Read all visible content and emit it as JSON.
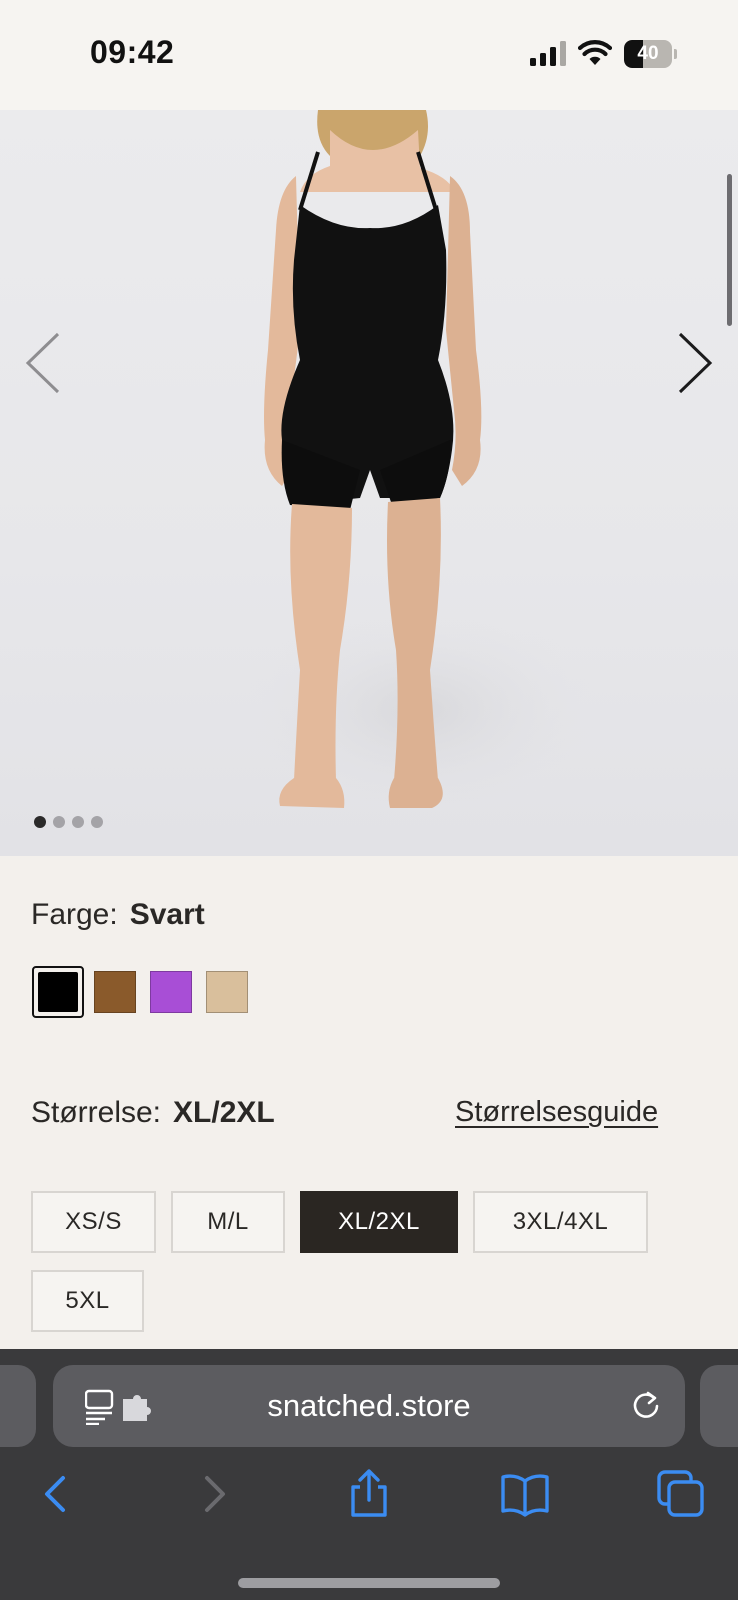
{
  "status_bar": {
    "time": "09:42",
    "battery_level": "40",
    "battery_fraction": 0.4
  },
  "gallery": {
    "image_count": 4,
    "active_index": 0,
    "prev_icon": "chevron-left-icon",
    "next_icon": "chevron-right-icon"
  },
  "color": {
    "label": "Farge:",
    "selected": "Svart",
    "swatches": [
      {
        "hex": "#000000",
        "selected": true
      },
      {
        "hex": "#8a5a2b",
        "selected": false
      },
      {
        "hex": "#a84ed6",
        "selected": false
      },
      {
        "hex": "#d9bf9c",
        "selected": false
      }
    ]
  },
  "size": {
    "label": "Størrelse:",
    "selected": "XL/2XL",
    "guide_link": "Størrelsesguide",
    "options": [
      "XS/S",
      "M/L",
      "XL/2XL",
      "3XL/4XL",
      "5XL"
    ]
  },
  "browser": {
    "url": "snatched.store"
  },
  "colors": {
    "page_bg": "#f3f0ec",
    "selected_size_bg": "#2a2622",
    "toolbar_accent": "#3b8cf2"
  }
}
